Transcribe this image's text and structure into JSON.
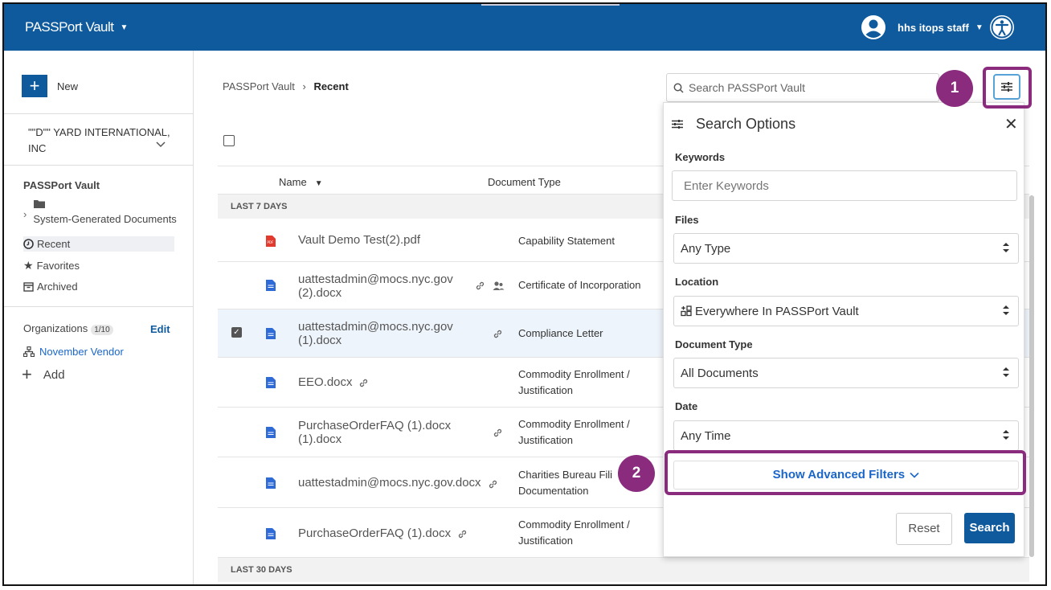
{
  "topbar": {
    "brand": "PASSPort Vault",
    "brand_caret": "▼",
    "user_name": "hhs itops staff",
    "user_caret": "▼"
  },
  "sidebar": {
    "new_label": "New",
    "vendor_name": "\"\"D\"\" YARD INTERNATIONAL, INC",
    "vault_title": "PASSPort Vault",
    "folder_label": "System-Generated Documents",
    "nav": [
      {
        "label": "Recent",
        "icon": "clock-icon"
      },
      {
        "label": "Favorites",
        "icon": "star-icon"
      },
      {
        "label": "Archived",
        "icon": "archive-icon"
      }
    ],
    "orgs_title": "Organizations",
    "orgs_count": "1/10",
    "edit_label": "Edit",
    "org_name": "November Vendor",
    "add_label": "Add"
  },
  "breadcrumb": {
    "root": "PASSPort Vault",
    "separator": "›",
    "current": "Recent"
  },
  "search": {
    "placeholder": "Search PASSPort Vault"
  },
  "table": {
    "col_name": "Name",
    "col_type": "Document Type",
    "group_recent": "LAST 7 DAYS",
    "group_older": "LAST 30 DAYS",
    "rows": [
      {
        "name": "Vault Demo Test(2).pdf",
        "type": "Capability Statement",
        "icon": "pdf-icon"
      },
      {
        "name": "uattestadmin@mocs.nyc.gov (2).docx",
        "type": "Certificate of Incorporation",
        "icon": "docx-icon"
      },
      {
        "name": "uattestadmin@mocs.nyc.gov (1).docx",
        "type": "Compliance Letter",
        "icon": "docx-icon",
        "selected": true
      },
      {
        "name": "EEO.docx",
        "type": "Commodity Enrollment / Justification",
        "icon": "docx-icon"
      },
      {
        "name": "PurchaseOrderFAQ (1).docx (1).docx",
        "type": "Commodity Enrollment / Justification",
        "icon": "docx-icon"
      },
      {
        "name": "uattestadmin@mocs.nyc.gov.docx",
        "type": "Charities Bureau Fili Documentation",
        "icon": "docx-icon"
      },
      {
        "name": "PurchaseOrderFAQ (1).docx",
        "type": "Commodity Enrollment / Justification",
        "icon": "docx-icon"
      }
    ]
  },
  "panel": {
    "title": "Search Options",
    "close": "✕",
    "keywords_label": "Keywords",
    "keywords_placeholder": "Enter Keywords",
    "files_label": "Files",
    "files_value": "Any Type",
    "location_label": "Location",
    "location_value": "Everywhere In PASSPort Vault",
    "doctype_label": "Document Type",
    "doctype_value": "All Documents",
    "date_label": "Date",
    "date_value": "Any Time",
    "advanced_label": "Show Advanced Filters",
    "reset_label": "Reset",
    "search_label": "Search"
  },
  "callouts": {
    "one": "1",
    "two": "2"
  },
  "colors": {
    "brand_blue": "#0f5a9c",
    "callout_purple": "#8a2b7d",
    "link_blue": "#1a66c9"
  }
}
